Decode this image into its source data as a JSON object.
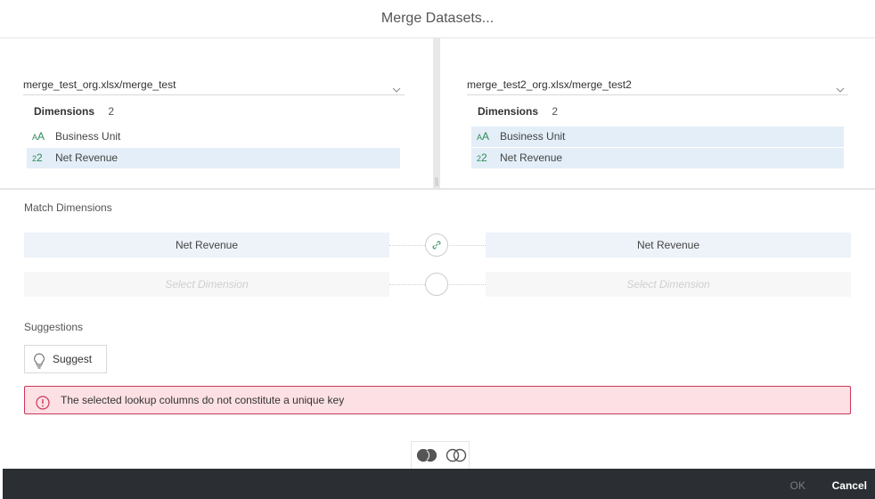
{
  "dialog": {
    "title": "Merge Datasets..."
  },
  "left_panel": {
    "dataset": "merge_test_org.xlsx/merge_test",
    "dimensions_label": "Dimensions",
    "dimensions_count": "2",
    "items": [
      {
        "icon": "text-type-icon",
        "glyph": "AA",
        "label": "Business Unit",
        "selected": false
      },
      {
        "icon": "number-type-icon",
        "glyph": "22",
        "label": "Net Revenue",
        "selected": true
      }
    ]
  },
  "right_panel": {
    "dataset": "merge_test2_org.xlsx/merge_test2",
    "dimensions_label": "Dimensions",
    "dimensions_count": "2",
    "items": [
      {
        "icon": "text-type-icon",
        "glyph": "AA",
        "label": "Business Unit",
        "selected": true
      },
      {
        "icon": "number-type-icon",
        "glyph": "22",
        "label": "Net Revenue",
        "selected": true
      }
    ]
  },
  "match": {
    "label": "Match Dimensions",
    "rows": [
      {
        "left": "Net Revenue",
        "right": "Net Revenue",
        "linked": true
      },
      {
        "left": "Select Dimension",
        "right": "Select Dimension",
        "linked": false
      }
    ]
  },
  "suggestions": {
    "label": "Suggestions",
    "button": "Suggest"
  },
  "error": {
    "message": "The selected lookup columns do not constitute a unique key"
  },
  "footer": {
    "ok": "OK",
    "cancel": "Cancel"
  },
  "colors": {
    "accent_green": "#2e8b57",
    "selection_bg": "#e3eef8",
    "error_border": "#c8385a",
    "error_bg": "#fde0e4",
    "footer_bg": "#2b2f33"
  }
}
